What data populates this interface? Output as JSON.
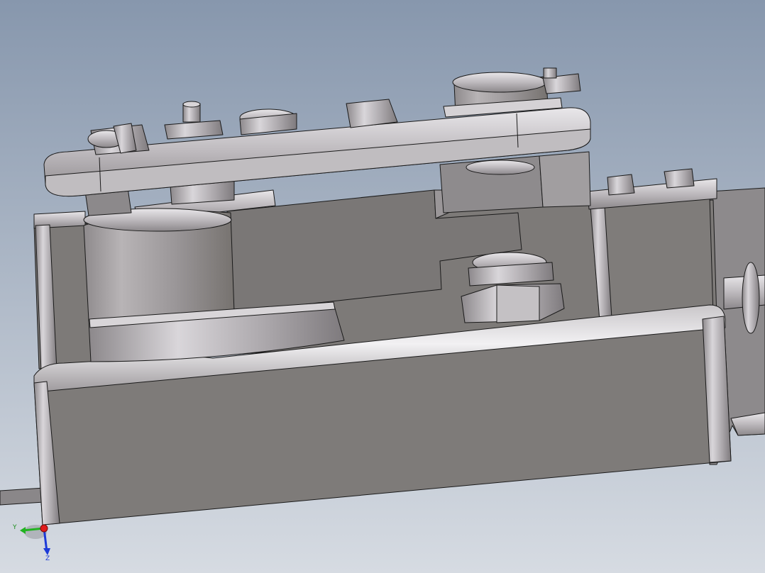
{
  "viewport": {
    "background_top": "#8797ad",
    "background_bottom": "#d6dbe2",
    "model_color": "#7d7a78",
    "edge_color": "#1a1a1a"
  },
  "triad": {
    "y_label": "Y",
    "z_label": "Z",
    "x_color": "#e01b1b",
    "y_color": "#22b322",
    "z_color": "#1c3ad8"
  }
}
